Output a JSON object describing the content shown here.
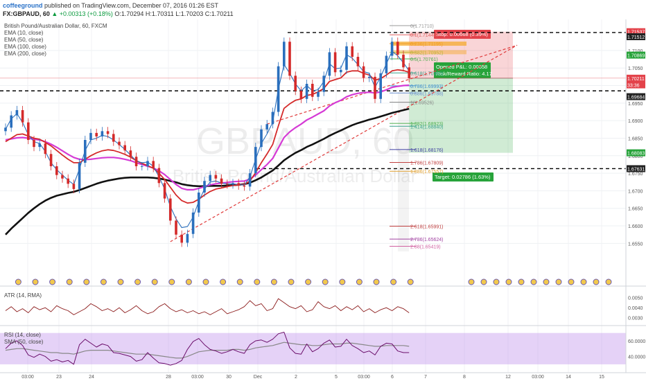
{
  "header": {
    "author": "coffeeground",
    "published": "published on TradingView.com, December 07, 2016 01:26 EST",
    "symbol": "FX:GBPAUD, 60",
    "change": "▲ +0.00313 (+0.18%)",
    "ohlc": "O:1.70294 H:1.70311 L:1.70203 C:1.70211"
  },
  "legend": {
    "title": "British Pound/Australian Dollar, 60, FXCM",
    "indicators": [
      "EMA (10, close)",
      "EMA (50, close)",
      "EMA (100, close)",
      "EMA (200, close)"
    ]
  },
  "watermark": {
    "big": "GBPAUD, 60",
    "small": "British Pound/Australian Dollar"
  },
  "colors": {
    "ema10": "#2a6fbd",
    "ema50": "#d42a2a",
    "ema100": "#d53ad5",
    "ema200": "#111111",
    "candle_up": "#2a6fbd",
    "candle_down": "#d42a2a",
    "stop": "#e3424a",
    "target": "#27a33a"
  },
  "chart_data": {
    "type": "line",
    "ylim": [
      1.645,
      1.7165
    ],
    "price_axis_labels": [
      "1.71537",
      "1.71512",
      "1.70869",
      "1.70211",
      "33:36",
      "1.69684",
      "1.68083",
      "1.67631"
    ],
    "grid_ticks": [
      "1.7100",
      "1.7050",
      "1.7000",
      "1.6950",
      "1.6900",
      "1.6850",
      "1.6800",
      "1.6750",
      "1.6700",
      "1.6650",
      "1.6600",
      "1.6550"
    ],
    "time_labels": [
      "03:00",
      "23",
      "24",
      "28",
      "03:00",
      "30",
      "Dec",
      "2",
      "5",
      "03:00",
      "6",
      "7",
      "8",
      "12",
      "03:00",
      "14",
      "15"
    ],
    "price_close": [
      1.688,
      1.6915,
      1.693,
      1.6895,
      1.6845,
      1.6825,
      1.6835,
      1.6805,
      1.677,
      1.6745,
      1.6735,
      1.672,
      1.6705,
      1.678,
      1.6845,
      1.6865,
      1.6855,
      1.687,
      1.6862,
      1.684,
      1.683,
      1.6815,
      1.6797,
      1.677,
      1.677,
      1.6785,
      1.6765,
      1.6722,
      1.6678,
      1.6615,
      1.6575,
      1.6552,
      1.6577,
      1.6638,
      1.6695,
      1.6728,
      1.6745,
      1.6735,
      1.672,
      1.6718,
      1.6722,
      1.6715,
      1.6712,
      1.675,
      1.6825,
      1.6875,
      1.689,
      1.6925,
      1.7055,
      1.7125,
      1.7028,
      1.6985,
      1.6962,
      1.7005,
      1.6968,
      1.6982,
      1.7028,
      1.7095,
      1.7038,
      1.7045,
      1.7112,
      1.7082,
      1.7055,
      1.7022,
      1.7025,
      1.6962,
      1.7035,
      1.7085,
      1.7125,
      1.7088,
      1.7052,
      1.7021
    ],
    "ema10": [
      1.6875,
      1.6905,
      1.692,
      1.6895,
      1.686,
      1.684,
      1.6835,
      1.6812,
      1.678,
      1.676,
      1.6745,
      1.673,
      1.6718,
      1.6762,
      1.6815,
      1.6845,
      1.685,
      1.6858,
      1.6855,
      1.6845,
      1.6832,
      1.6818,
      1.6802,
      1.6785,
      1.678,
      1.6782,
      1.677,
      1.674,
      1.6705,
      1.6655,
      1.662,
      1.6595,
      1.6598,
      1.6625,
      1.667,
      1.6705,
      1.6725,
      1.6728,
      1.6722,
      1.672,
      1.672,
      1.6718,
      1.6716,
      1.674,
      1.679,
      1.6835,
      1.6862,
      1.6895,
      1.699,
      1.706,
      1.7035,
      1.7005,
      1.6985,
      1.7,
      1.6985,
      1.6988,
      1.7012,
      1.7062,
      1.7048,
      1.705,
      1.7088,
      1.7078,
      1.706,
      1.704,
      1.7035,
      1.6995,
      1.7025,
      1.7062,
      1.7098,
      1.7085,
      1.7065,
      1.7042
    ],
    "ema50": [
      1.684,
      1.685,
      1.686,
      1.6862,
      1.6856,
      1.685,
      1.6847,
      1.6838,
      1.6828,
      1.6815,
      1.6802,
      1.679,
      1.678,
      1.678,
      1.679,
      1.68,
      1.6808,
      1.6814,
      1.6817,
      1.6815,
      1.681,
      1.6804,
      1.6796,
      1.6786,
      1.6778,
      1.6772,
      1.6764,
      1.675,
      1.6732,
      1.671,
      1.6688,
      1.6672,
      1.6665,
      1.6667,
      1.6676,
      1.6688,
      1.6698,
      1.6705,
      1.6708,
      1.6712,
      1.6715,
      1.6717,
      1.6718,
      1.6728,
      1.6752,
      1.678,
      1.6805,
      1.6832,
      1.6885,
      1.6935,
      1.6948,
      1.6958,
      1.6962,
      1.6972,
      1.6975,
      1.6982,
      1.6992,
      1.7012,
      1.7017,
      1.7022,
      1.7038,
      1.7042,
      1.7042,
      1.7035,
      1.703,
      1.7015,
      1.702,
      1.703,
      1.7042,
      1.7045,
      1.7043,
      1.7038
    ],
    "ema100": [
      1.6845,
      1.6848,
      1.6851,
      1.6852,
      1.685,
      1.6847,
      1.6845,
      1.684,
      1.6833,
      1.6824,
      1.6814,
      1.6804,
      1.6795,
      1.679,
      1.6789,
      1.679,
      1.6792,
      1.6794,
      1.6795,
      1.6795,
      1.6793,
      1.679,
      1.6786,
      1.678,
      1.6775,
      1.677,
      1.6765,
      1.6757,
      1.6746,
      1.6732,
      1.6718,
      1.6707,
      1.6703,
      1.6703,
      1.6707,
      1.6712,
      1.6717,
      1.672,
      1.6722,
      1.6724,
      1.6726,
      1.6727,
      1.6728,
      1.6733,
      1.6745,
      1.676,
      1.6775,
      1.6792,
      1.6822,
      1.6852,
      1.6868,
      1.688,
      1.689,
      1.6902,
      1.691,
      1.6919,
      1.6928,
      1.6942,
      1.6951,
      1.6958,
      1.6968,
      1.6974,
      1.6978,
      1.698,
      1.6981,
      1.6979,
      1.6982,
      1.6988,
      1.6995,
      1.6998,
      1.7,
      1.7001
    ],
    "ema200": [
      1.6575,
      1.6592,
      1.6607,
      1.6622,
      1.6637,
      1.665,
      1.6662,
      1.6672,
      1.668,
      1.6686,
      1.669,
      1.6694,
      1.6697,
      1.6702,
      1.6708,
      1.6714,
      1.672,
      1.6725,
      1.6729,
      1.6732,
      1.6735,
      1.6737,
      1.6738,
      1.6738,
      1.6738,
      1.6738,
      1.6737,
      1.6735,
      1.6732,
      1.6728,
      1.6724,
      1.6719,
      1.6716,
      1.6714,
      1.6713,
      1.6713,
      1.6714,
      1.6714,
      1.6714,
      1.6715,
      1.6716,
      1.6717,
      1.6719,
      1.6723,
      1.673,
      1.6738,
      1.6748,
      1.6758,
      1.6772,
      1.6787,
      1.6798,
      1.6808,
      1.6816,
      1.6825,
      1.6832,
      1.684,
      1.6848,
      1.6857,
      1.6865,
      1.6872,
      1.688,
      1.6887,
      1.6893,
      1.6898,
      1.6903,
      1.6907,
      1.6912,
      1.6917,
      1.6922,
      1.6926,
      1.693,
      1.6934
    ],
    "horizontal_levels": [
      1.71512,
      1.6985,
      1.67631
    ],
    "trendline": {
      "from": [
        29,
        1.6555
      ],
      "to": [
        90,
        1.7115
      ]
    },
    "trendline2": {
      "from": [
        46,
        1.689
      ],
      "to": [
        90,
        1.7115
      ]
    },
    "fib_levels": [
      {
        "label": "0(1.71710)",
        "price": 1.7171
      },
      {
        "label": "0.1(1.71448)",
        "price": 1.71448
      },
      {
        "label": "0.236(1.71195)",
        "price": 1.71195
      },
      {
        "label": "0.382(1.70952)",
        "price": 1.70952
      },
      {
        "label": "0.5(1.70761)",
        "price": 1.70761
      },
      {
        "label": "0.618(1.70360)",
        "price": 1.7036
      },
      {
        "label": "0.786(1.69993)",
        "price": 1.69993
      },
      {
        "label": "0.886(1.69788)",
        "price": 1.69788
      },
      {
        "label": "1(1.69526)",
        "price": 1.69526
      },
      {
        "label": "1.382(1.68923)",
        "price": 1.68923
      },
      {
        "label": "1.414(1.68840)",
        "price": 1.6884
      },
      {
        "label": "1.618(1.68176)",
        "price": 1.68176
      },
      {
        "label": "1.786(1.67809)",
        "price": 1.67809
      },
      {
        "label": "1.886(1.67557)",
        "price": 1.67557
      },
      {
        "label": "2.618(1.65991)",
        "price": 1.65991
      },
      {
        "label": "2.786(1.65624)",
        "price": 1.65624
      },
      {
        "label": "2.88(1.65419)",
        "price": 1.65419
      }
    ],
    "position": {
      "entry": 1.70211,
      "stop": 1.71537,
      "target": 1.68083,
      "stop_label": "Stop: 0.00668 (0.39%)",
      "open_label": "Opened P&L: 0.00658",
      "rr_label": "Risk/Reward Ratio: 4.17",
      "target_label": "Target: 0.02786 (1.63%)"
    },
    "atr": {
      "title": "ATR (14, RMA)",
      "ylim": [
        0.0025,
        0.0058
      ],
      "ticks": [
        "0.0050",
        "0.0040",
        "0.0030"
      ],
      "values": [
        0.0037,
        0.0041,
        0.0036,
        0.0039,
        0.0035,
        0.0041,
        0.0038,
        0.004,
        0.0036,
        0.0042,
        0.0039,
        0.0037,
        0.0033,
        0.0036,
        0.0039,
        0.0044,
        0.0041,
        0.0037,
        0.0039,
        0.0036,
        0.004,
        0.0035,
        0.0038,
        0.0042,
        0.0037,
        0.0034,
        0.0036,
        0.0041,
        0.0044,
        0.0039,
        0.0036,
        0.0038,
        0.0035,
        0.0037,
        0.0034,
        0.0036,
        0.0033,
        0.0036,
        0.0039,
        0.0034,
        0.0036,
        0.0038,
        0.0041,
        0.0047,
        0.0042,
        0.0044,
        0.0037,
        0.0039,
        0.0049,
        0.0045,
        0.0041,
        0.0039,
        0.0042,
        0.0036,
        0.0038,
        0.0046,
        0.0041,
        0.0039,
        0.0042,
        0.0037,
        0.0041,
        0.0038,
        0.0042,
        0.0036,
        0.0039,
        0.0035,
        0.0038,
        0.004,
        0.0037,
        0.0041,
        0.0039,
        0.0035
      ]
    },
    "rsi": {
      "title": "RSI (14, close)",
      "ma_title": "SMA (50, close)",
      "ylim": [
        22,
        75
      ],
      "ticks": [
        "60.0000",
        "40.0000"
      ],
      "band": [
        30,
        70
      ],
      "values": [
        50,
        57,
        60,
        54,
        42,
        39,
        43,
        40,
        34,
        36,
        33,
        35,
        30,
        55,
        62,
        57,
        52,
        56,
        54,
        45,
        44,
        42,
        40,
        34,
        36,
        45,
        38,
        32,
        31,
        29,
        31,
        35,
        49,
        59,
        63,
        55,
        49,
        47,
        44,
        46,
        49,
        46,
        44,
        55,
        60,
        61,
        58,
        62,
        69,
        71,
        51,
        44,
        43,
        56,
        46,
        50,
        57,
        61,
        52,
        53,
        62,
        54,
        50,
        45,
        47,
        42,
        53,
        57,
        56,
        47,
        45,
        45
      ],
      "ma": [
        48,
        49,
        50,
        50,
        49,
        48,
        47,
        46,
        45,
        45,
        44,
        44,
        43,
        45,
        47,
        48,
        48,
        48,
        48,
        47,
        46,
        45,
        44,
        43,
        43,
        43,
        42,
        41,
        40,
        39,
        38,
        38,
        40,
        43,
        46,
        47,
        48,
        48,
        48,
        48,
        49,
        49,
        48,
        49,
        51,
        52,
        53,
        54,
        56,
        58,
        57,
        56,
        55,
        55,
        54,
        54,
        55,
        56,
        56,
        56,
        57,
        57,
        56,
        55,
        54,
        53,
        53,
        54,
        54,
        54,
        54,
        53
      ]
    }
  }
}
